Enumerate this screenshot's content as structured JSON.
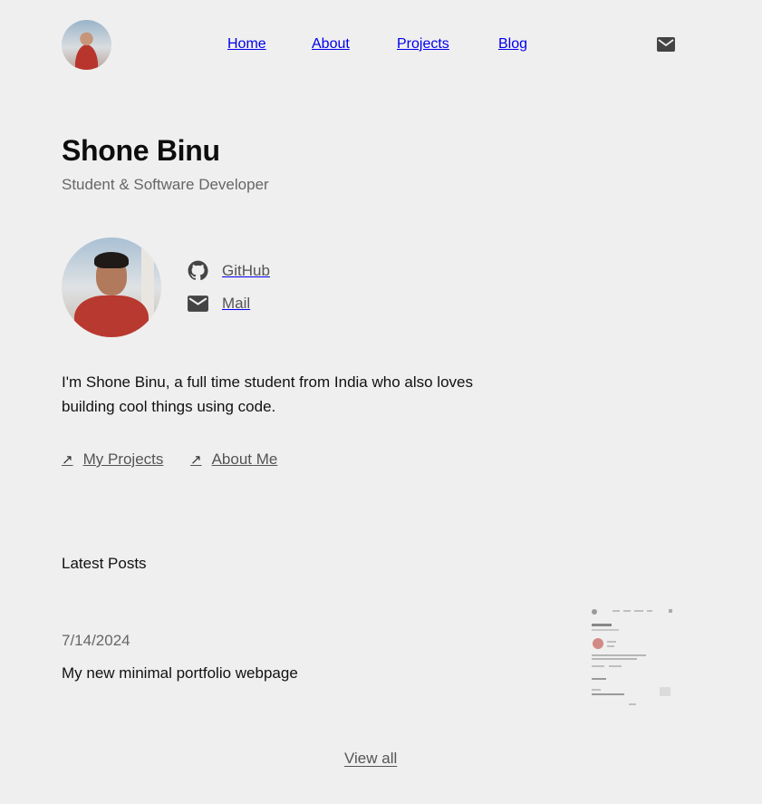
{
  "header": {
    "nav": [
      {
        "label": "Home"
      },
      {
        "label": "About"
      },
      {
        "label": "Projects"
      },
      {
        "label": "Blog"
      }
    ]
  },
  "hero": {
    "name": "Shone Binu",
    "role": "Student & Software Developer"
  },
  "social": [
    {
      "icon": "github-icon",
      "label": "GitHub"
    },
    {
      "icon": "mail-icon",
      "label": "Mail"
    }
  ],
  "bio": "I'm Shone Binu, a full time student from India who also loves building cool things using code.",
  "links": [
    {
      "label": "My Projects"
    },
    {
      "label": "About Me"
    }
  ],
  "latest": {
    "heading": "Latest Posts",
    "posts": [
      {
        "date": "7/14/2024",
        "title": "My new minimal portfolio webpage"
      }
    ],
    "view_all": "View all"
  }
}
